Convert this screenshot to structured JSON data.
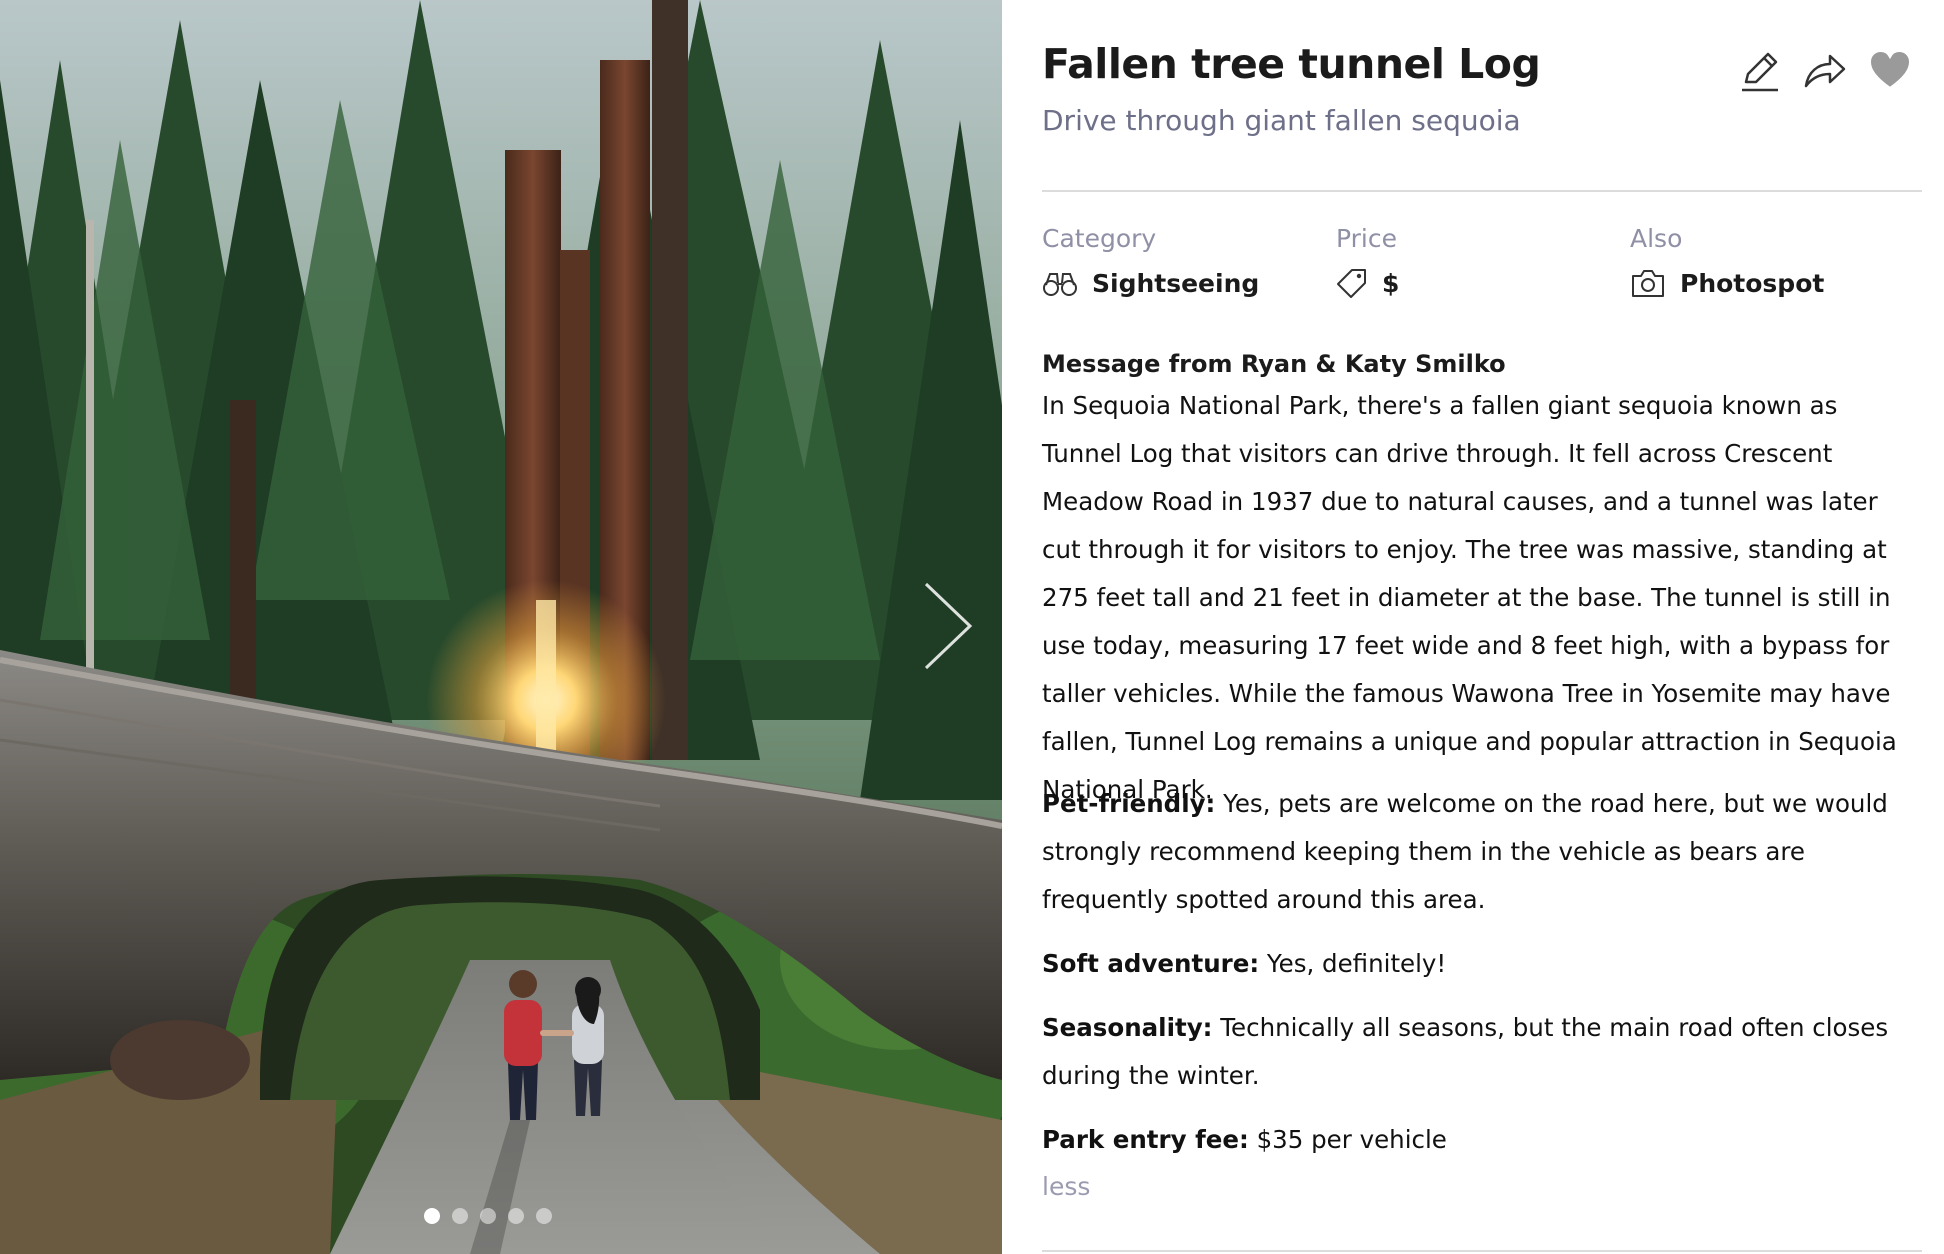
{
  "gallery": {
    "photo_name": "photo-forest-tunnel-log",
    "next_icon": "chevron-right-icon",
    "slide_count": 5,
    "active_slide": 1
  },
  "place": {
    "title": "Fallen tree tunnel Log",
    "subtitle": "Drive through giant fallen sequoia"
  },
  "actions": {
    "edit_icon": "pencil-icon",
    "share_icon": "share-arrow-icon",
    "favorite_icon": "heart-icon"
  },
  "meta": {
    "category_label": "Category",
    "category_value": "Sightseeing",
    "category_icon": "binoculars-icon",
    "price_label": "Price",
    "price_value": "$",
    "price_icon": "tag-icon",
    "also_label": "Also",
    "also_value": "Photospot",
    "also_icon": "camera-icon"
  },
  "message": {
    "heading": "Message from Ryan & Katy Smilko",
    "body": "In Sequoia National Park, there's a fallen giant sequoia known as Tunnel Log that visitors can drive through. It fell across Crescent Meadow Road in 1937 due to natural causes, and a tunnel was later cut through it for visitors to enjoy. The tree was massive, standing at 275 feet tall and 21 feet in diameter at the base. The tunnel is still in use today, measuring 17 feet wide and 8 feet high, with a bypass for taller vehicles. While the famous Wawona Tree in Yosemite may have fallen, Tunnel Log remains a unique and popular attraction in Sequoia National Park."
  },
  "details": {
    "pet_label": "Pet-friendly:",
    "pet_text": " Yes, pets are welcome on the road here, but we would strongly recommend keeping them in the vehicle as bears are frequently spotted around this area.",
    "soft_label": "Soft adventure:",
    "soft_text": " Yes, definitely!",
    "season_label": "Seasonality:",
    "season_text": " Technically all seasons, but the main road often closes during the winter.",
    "fee_label": "Park entry fee:",
    "fee_text": " $35 per vehicle"
  },
  "toggle": {
    "less_label": "less"
  },
  "colors": {
    "title": "#1b1b1b",
    "subtitle": "#6e6f88",
    "muted": "#8f90a6",
    "divider": "#dcdcdc",
    "heart": "#9a9a9a"
  }
}
